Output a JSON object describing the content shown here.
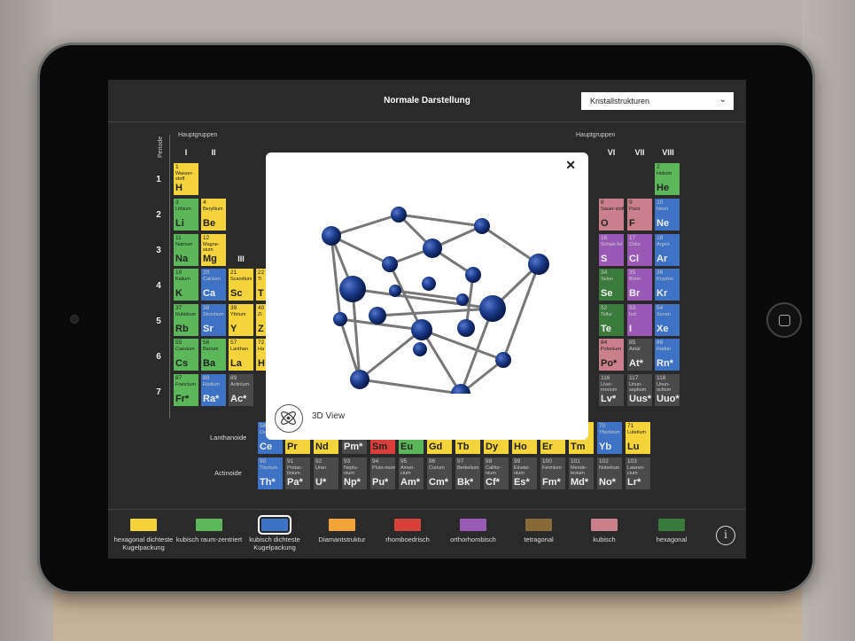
{
  "header": {
    "title": "Normale Darstellung",
    "dropdown_value": "Kristallstrukturen"
  },
  "labels": {
    "hauptgruppen": "Hauptgruppen",
    "periode": "Periode",
    "lanthanoide": "Lanthanoide",
    "actinoide": "Actinoide"
  },
  "roman_left": [
    "I",
    "II",
    "III"
  ],
  "roman_right": [
    "VI",
    "VII",
    "VIII"
  ],
  "periods": [
    "1",
    "2",
    "3",
    "4",
    "5",
    "6",
    "7"
  ],
  "modal": {
    "close_label": "✕",
    "view_label": "3D View"
  },
  "colors": {
    "yellow": "#f5d33b",
    "green": "#5cb75a",
    "blue": "#3d72c4",
    "orange": "#f2a33a",
    "red": "#d9403b",
    "purple": "#9b59b6",
    "brown": "#8a6a3a",
    "pink": "#c9808a",
    "darkgreen": "#3a7a3a",
    "gray": "#4a4a4a"
  },
  "cells": [
    {
      "n": "1",
      "name": "Wasser-stoff",
      "sym": "H",
      "c": "yellow"
    },
    {
      "n": "3",
      "name": "Lithium",
      "sym": "Li",
      "c": "green"
    },
    {
      "n": "4",
      "name": "Beryllium",
      "sym": "Be",
      "c": "yellow"
    },
    {
      "n": "11",
      "name": "Natrium",
      "sym": "Na",
      "c": "green"
    },
    {
      "n": "12",
      "name": "Magne-sium",
      "sym": "Mg",
      "c": "yellow"
    },
    {
      "n": "19",
      "name": "Kalium",
      "sym": "K",
      "c": "green"
    },
    {
      "n": "20",
      "name": "Calcium",
      "sym": "Ca",
      "c": "blue"
    },
    {
      "n": "21",
      "name": "Scandium",
      "sym": "Sc",
      "c": "yellow"
    },
    {
      "n": "22",
      "name": "Ti",
      "sym": "T",
      "c": "yellow"
    },
    {
      "n": "37",
      "name": "Rubidium",
      "sym": "Rb",
      "c": "green"
    },
    {
      "n": "38",
      "name": "Strontium",
      "sym": "Sr",
      "c": "blue"
    },
    {
      "n": "39",
      "name": "Yttrium",
      "sym": "Y",
      "c": "yellow"
    },
    {
      "n": "40",
      "name": "Zi",
      "sym": "Z",
      "c": "yellow"
    },
    {
      "n": "55",
      "name": "Caesium",
      "sym": "Cs",
      "c": "green"
    },
    {
      "n": "56",
      "name": "Barium",
      "sym": "Ba",
      "c": "green"
    },
    {
      "n": "57",
      "name": "Lanthan",
      "sym": "La",
      "c": "yellow"
    },
    {
      "n": "72",
      "name": "Ha",
      "sym": "H",
      "c": "yellow"
    },
    {
      "n": "87",
      "name": "Francium",
      "sym": "Fr*",
      "c": "green"
    },
    {
      "n": "88",
      "name": "Radium",
      "sym": "Ra*",
      "c": "blue"
    },
    {
      "n": "89",
      "name": "Actinium",
      "sym": "Ac*",
      "c": "gray"
    },
    {
      "n": "2",
      "name": "Helium",
      "sym": "He",
      "c": "green"
    },
    {
      "n": "8",
      "name": "Sauer-stoff",
      "sym": "O",
      "c": "pink"
    },
    {
      "n": "9",
      "name": "Fluor",
      "sym": "F",
      "c": "pink"
    },
    {
      "n": "10",
      "name": "Neon",
      "sym": "Ne",
      "c": "blue"
    },
    {
      "n": "16",
      "name": "Schwe-fel",
      "sym": "S",
      "c": "purple"
    },
    {
      "n": "17",
      "name": "Chlor",
      "sym": "Cl",
      "c": "purple"
    },
    {
      "n": "18",
      "name": "Argon",
      "sym": "Ar",
      "c": "blue"
    },
    {
      "n": "34",
      "name": "Selen",
      "sym": "Se",
      "c": "darkgreen"
    },
    {
      "n": "35",
      "name": "Brom",
      "sym": "Br",
      "c": "purple"
    },
    {
      "n": "36",
      "name": "Krypton",
      "sym": "Kr",
      "c": "blue"
    },
    {
      "n": "52",
      "name": "Tellur",
      "sym": "Te",
      "c": "darkgreen"
    },
    {
      "n": "53",
      "name": "Iod",
      "sym": "I",
      "c": "purple"
    },
    {
      "n": "54",
      "name": "Xenon",
      "sym": "Xe",
      "c": "blue"
    },
    {
      "n": "84",
      "name": "Polonium",
      "sym": "Po*",
      "c": "pink"
    },
    {
      "n": "85",
      "name": "Astat",
      "sym": "At*",
      "c": "gray"
    },
    {
      "n": "86",
      "name": "Radon",
      "sym": "Rn*",
      "c": "blue"
    },
    {
      "n": "116",
      "name": "Liver-morium",
      "sym": "Lv*",
      "c": "gray"
    },
    {
      "n": "117",
      "name": "Unun-septium",
      "sym": "Uus*",
      "c": "gray"
    },
    {
      "n": "118",
      "name": "Unun-octium",
      "sym": "Uuo*",
      "c": "gray"
    },
    {
      "n": "58",
      "name": "Cer",
      "sym": "Ce",
      "c": "blue"
    },
    {
      "n": "59",
      "name": "Pra",
      "sym": "Pr",
      "c": "yellow"
    },
    {
      "n": "60",
      "name": "Neo",
      "sym": "Nd",
      "c": "yellow"
    },
    {
      "n": "61",
      "name": "Prom",
      "sym": "Pm*",
      "c": "gray"
    },
    {
      "n": "62",
      "name": "Sam",
      "sym": "Sm",
      "c": "red"
    },
    {
      "n": "63",
      "name": "Eur",
      "sym": "Eu",
      "c": "green"
    },
    {
      "n": "64",
      "name": "Gad",
      "sym": "Gd",
      "c": "yellow"
    },
    {
      "n": "65",
      "name": "Ter",
      "sym": "Tb",
      "c": "yellow"
    },
    {
      "n": "66",
      "name": "Dys",
      "sym": "Dy",
      "c": "yellow"
    },
    {
      "n": "67",
      "name": "Hol",
      "sym": "Ho",
      "c": "yellow"
    },
    {
      "n": "68",
      "name": "Erb",
      "sym": "Er",
      "c": "yellow"
    },
    {
      "n": "69",
      "name": "Thu",
      "sym": "Tm",
      "c": "yellow"
    },
    {
      "n": "70",
      "name": "Ytterbium",
      "sym": "Yb",
      "c": "blue"
    },
    {
      "n": "71",
      "name": "Lutetium",
      "sym": "Lu",
      "c": "yellow"
    },
    {
      "n": "90",
      "name": "Thorium",
      "sym": "Th*",
      "c": "blue"
    },
    {
      "n": "91",
      "name": "Protac-tinium",
      "sym": "Pa*",
      "c": "gray"
    },
    {
      "n": "92",
      "name": "Uran",
      "sym": "U*",
      "c": "gray"
    },
    {
      "n": "93",
      "name": "Neptu-nium",
      "sym": "Np*",
      "c": "gray"
    },
    {
      "n": "94",
      "name": "Pluto-nium",
      "sym": "Pu*",
      "c": "gray"
    },
    {
      "n": "95",
      "name": "Ameri-cium",
      "sym": "Am*",
      "c": "gray"
    },
    {
      "n": "96",
      "name": "Curium",
      "sym": "Cm*",
      "c": "gray"
    },
    {
      "n": "97",
      "name": "Berkelium",
      "sym": "Bk*",
      "c": "gray"
    },
    {
      "n": "98",
      "name": "Califor-nium",
      "sym": "Cf*",
      "c": "gray"
    },
    {
      "n": "99",
      "name": "Einstei-nium",
      "sym": "Es*",
      "c": "gray"
    },
    {
      "n": "100",
      "name": "Fermium",
      "sym": "Fm*",
      "c": "gray"
    },
    {
      "n": "101",
      "name": "Mende-levium",
      "sym": "Md*",
      "c": "gray"
    },
    {
      "n": "102",
      "name": "Nobelium",
      "sym": "No*",
      "c": "gray"
    },
    {
      "n": "103",
      "name": "Lawren-cium",
      "sym": "Lr*",
      "c": "gray"
    }
  ],
  "legend": [
    {
      "label": "hexagonal dichteste Kugelpackung",
      "c": "yellow",
      "selected": false
    },
    {
      "label": "kubisch raum-zentriert",
      "c": "green",
      "selected": false
    },
    {
      "label": "kubisch dichteste Kugelpackung",
      "c": "blue",
      "selected": true
    },
    {
      "label": "Diamantstruktur",
      "c": "orange",
      "selected": false
    },
    {
      "label": "rhomboedrisch",
      "c": "red",
      "selected": false
    },
    {
      "label": "orthorhombisch",
      "c": "purple",
      "selected": false
    },
    {
      "label": "tetragonal",
      "c": "brown",
      "selected": false
    },
    {
      "label": "kubisch",
      "c": "pink",
      "selected": false
    },
    {
      "label": "hexagonal",
      "c": "darkgreen",
      "selected": false
    }
  ],
  "info_label": "i"
}
